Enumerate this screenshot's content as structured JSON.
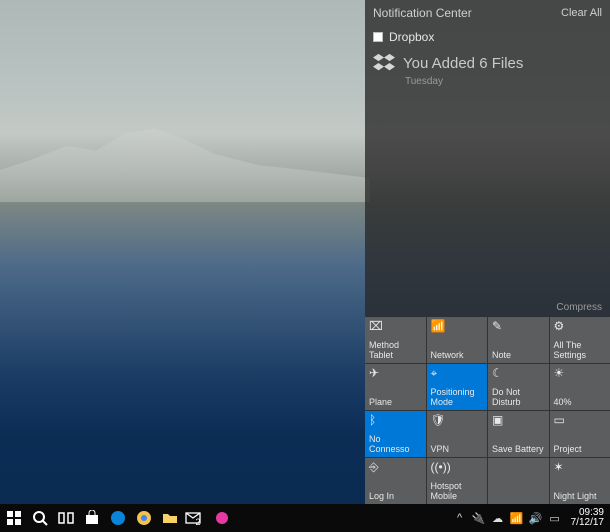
{
  "panel": {
    "title": "Notification Center",
    "clear_label": "Clear All",
    "compress_label": "Compress",
    "notifications": [
      {
        "app": "Dropbox",
        "title": "You Added 6 Files",
        "subtitle": "Tuesday",
        "icon_name": "dropbox-icon"
      }
    ]
  },
  "tiles": [
    {
      "label": "Method\nTablet",
      "icon_glyph": "⌧",
      "icon_name": "tablet-mode-icon",
      "active": false
    },
    {
      "label": "Network",
      "icon_glyph": "📶",
      "icon_name": "network-icon",
      "active": false
    },
    {
      "label": "Note",
      "icon_glyph": "✎",
      "icon_name": "note-icon",
      "active": false
    },
    {
      "label": "All The\nSettings",
      "icon_glyph": "⚙",
      "icon_name": "settings-icon",
      "active": false
    },
    {
      "label": "Plane",
      "icon_glyph": "✈",
      "icon_name": "airplane-icon",
      "active": false
    },
    {
      "label": "Positioning Mode",
      "icon_glyph": "⌖",
      "icon_name": "location-icon",
      "active": true
    },
    {
      "label": "Do Not Disturb",
      "icon_glyph": "☾",
      "icon_name": "moon-icon",
      "active": false
    },
    {
      "label": "40%",
      "icon_glyph": "☀",
      "icon_name": "brightness-icon",
      "active": false
    },
    {
      "label": "No Connesso",
      "icon_glyph": "ᛒ",
      "icon_name": "bluetooth-icon",
      "active": true
    },
    {
      "label": "VPN",
      "icon_glyph": "🛡",
      "icon_name": "vpn-icon",
      "active": false
    },
    {
      "label": "Save\nBattery",
      "icon_glyph": "▣",
      "icon_name": "battery-saver-icon",
      "active": false
    },
    {
      "label": "Project",
      "icon_glyph": "▭",
      "icon_name": "project-icon",
      "active": false
    },
    {
      "label": "Log In",
      "icon_glyph": "⎆",
      "icon_name": "connect-icon",
      "active": false
    },
    {
      "label": "Hotspot\nMobile",
      "icon_glyph": "((•))",
      "icon_name": "hotspot-icon",
      "active": false
    },
    {
      "label": "",
      "icon_glyph": "",
      "icon_name": "blank-tile",
      "active": false
    },
    {
      "label": "Night Light",
      "icon_glyph": "✶",
      "icon_name": "night-light-icon",
      "active": false
    }
  ],
  "taskbar": {
    "left": [
      {
        "name": "start-button",
        "color": "#ffffff",
        "glyph": "win"
      },
      {
        "name": "search-button",
        "color": "#ffffff",
        "glyph": "search"
      },
      {
        "name": "task-view-button",
        "color": "#ffffff",
        "glyph": "taskv"
      },
      {
        "name": "store-app",
        "color": "#ffffff",
        "glyph": "store"
      },
      {
        "name": "edge-app",
        "color": "#0a84d6",
        "glyph": "edge"
      },
      {
        "name": "chrome-app",
        "color": "#f2c14e",
        "glyph": "chrome"
      },
      {
        "name": "explorer-app",
        "color": "#f8d267",
        "glyph": "folder"
      },
      {
        "name": "mail-app",
        "color": "#ffffff",
        "glyph": "mail"
      },
      {
        "name": "app-pink",
        "color": "#e63aa0",
        "glyph": "dot"
      }
    ],
    "mail_badge": "2",
    "systray": [
      {
        "name": "tray-chevron-icon",
        "glyph": "^"
      },
      {
        "name": "power-icon",
        "glyph": "🔌"
      },
      {
        "name": "onedrive-icon",
        "glyph": "☁"
      },
      {
        "name": "wifi-icon",
        "glyph": "📶"
      },
      {
        "name": "volume-icon",
        "glyph": "🔊"
      },
      {
        "name": "action-center-icon",
        "glyph": "▭"
      }
    ],
    "clock": {
      "time": "09:39",
      "date": "7/12/17"
    }
  }
}
